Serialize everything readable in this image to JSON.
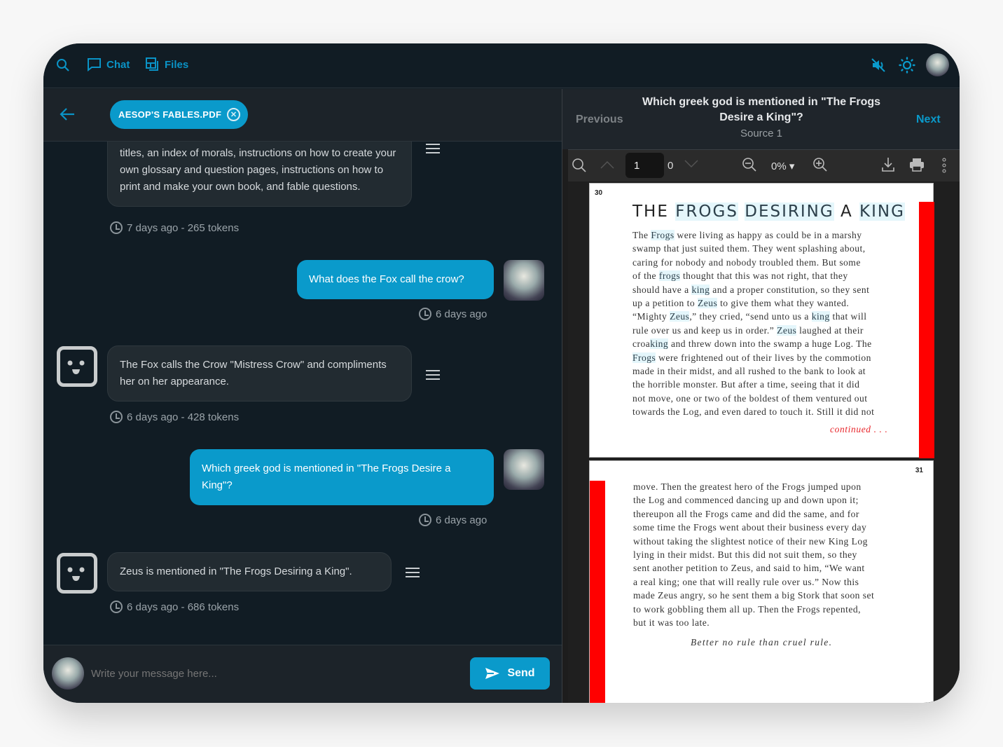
{
  "topbar": {
    "nav": [
      {
        "label": "Chat",
        "icon": "chat-bubble-icon"
      },
      {
        "label": "Files",
        "icon": "files-icon"
      }
    ],
    "icons": [
      "search-icon",
      "mute-icon",
      "sun-icon",
      "user-avatar"
    ]
  },
  "chat_header": {
    "file_chip": "AESOP'S FABLES.PDF"
  },
  "messages": [
    {
      "role": "bot",
      "text": "titles, an index of morals, instructions on how to create your own glossary and question pages, instructions on how to print and make your own book, and fable questions.",
      "meta": "7 days ago - 265 tokens"
    },
    {
      "role": "user",
      "text": "What does the Fox call the crow?",
      "meta": "6 days ago"
    },
    {
      "role": "bot",
      "text": "The Fox calls the Crow \"Mistress Crow\" and compliments her on her appearance.",
      "meta": "6 days ago - 428 tokens"
    },
    {
      "role": "user",
      "text": "Which greek god is mentioned in \"The Frogs Desire a King\"?",
      "meta": "6 days ago"
    },
    {
      "role": "bot",
      "text": "Zeus is mentioned in \"The Frogs Desiring a King\".",
      "meta": "6 days ago - 686 tokens"
    }
  ],
  "composer": {
    "placeholder": "Write your message here...",
    "send_label": "Send"
  },
  "source_viewer": {
    "previous_label": "Previous",
    "next_label": "Next",
    "question": "Which greek god is mentioned in \"The Frogs Desire a King\"?",
    "source_label": "Source 1"
  },
  "pdf_toolbar": {
    "page_input": "1",
    "page_count": "0",
    "zoom": "0%"
  },
  "pdf": {
    "page_a_number": "30",
    "title": [
      [
        "THE ",
        false
      ],
      [
        "FROGS",
        true
      ],
      [
        " ",
        false
      ],
      [
        "DESIRING",
        true
      ],
      [
        " A ",
        false
      ],
      [
        "KING",
        true
      ]
    ],
    "page_a_lines": [
      [
        [
          "The ",
          false
        ],
        [
          "Frogs",
          true
        ],
        [
          " were living as happy as could be in a marshy",
          false
        ]
      ],
      [
        [
          "swamp that just suited them. They went splashing about,",
          false
        ]
      ],
      [
        [
          "caring for nobody and nobody troubled them. But some",
          false
        ]
      ],
      [
        [
          "of the ",
          false
        ],
        [
          "frogs",
          true
        ],
        [
          " thought that this was not right, that they",
          false
        ]
      ],
      [
        [
          "should have a ",
          false
        ],
        [
          "king",
          true
        ],
        [
          " and a proper constitution, so they sent",
          false
        ]
      ],
      [
        [
          "up a petition to ",
          false
        ],
        [
          "Zeus",
          true
        ],
        [
          " to give them what they wanted.",
          false
        ]
      ],
      [
        [
          "“Mighty ",
          false
        ],
        [
          "Zeus",
          true
        ],
        [
          ",” they cried, “send unto us a ",
          false
        ],
        [
          "king",
          true
        ],
        [
          " that will",
          false
        ]
      ],
      [
        [
          "rule over us and keep us in order.” ",
          false
        ],
        [
          "Zeus",
          true
        ],
        [
          " laughed at their",
          false
        ]
      ],
      [
        [
          "croa",
          false
        ],
        [
          "king",
          true
        ],
        [
          " and threw down into the swamp a huge Log. The",
          false
        ]
      ],
      [
        [
          "Frogs",
          true
        ],
        [
          " were frightened out of their lives by the commotion",
          false
        ]
      ],
      [
        [
          "made in their midst, and all rushed to the bank to look at",
          false
        ]
      ],
      [
        [
          "the horrible monster. But after a time, seeing that it did",
          false
        ]
      ],
      [
        [
          "not move, one or two of the boldest of them ventured out",
          false
        ]
      ],
      [
        [
          "towards the Log, and even dared to touch it. Still it did not",
          false
        ]
      ]
    ],
    "continued": "continued . . .",
    "page_b_number": "31",
    "page_b_lines": [
      "move. Then the greatest hero of the Frogs jumped upon",
      "the Log and commenced dancing up and down upon it;",
      "thereupon all the Frogs came and did the same, and for",
      "some time the Frogs went about their business every day",
      "without taking the slightest notice of their new King Log",
      "lying in their midst. But this did not suit them, so they",
      "sent another petition to Zeus, and said to him, “We want",
      "a real king; one that will really rule over us.” Now this",
      "made Zeus angry, so he sent them a big Stork that soon set",
      "to work gobbling them all up. Then the Frogs repented,",
      "but it was too late."
    ],
    "moral": "Better no rule than cruel rule."
  },
  "colors": {
    "accent": "#0a9acb",
    "background": "#111c24",
    "margin_bar": "#ff0000"
  }
}
